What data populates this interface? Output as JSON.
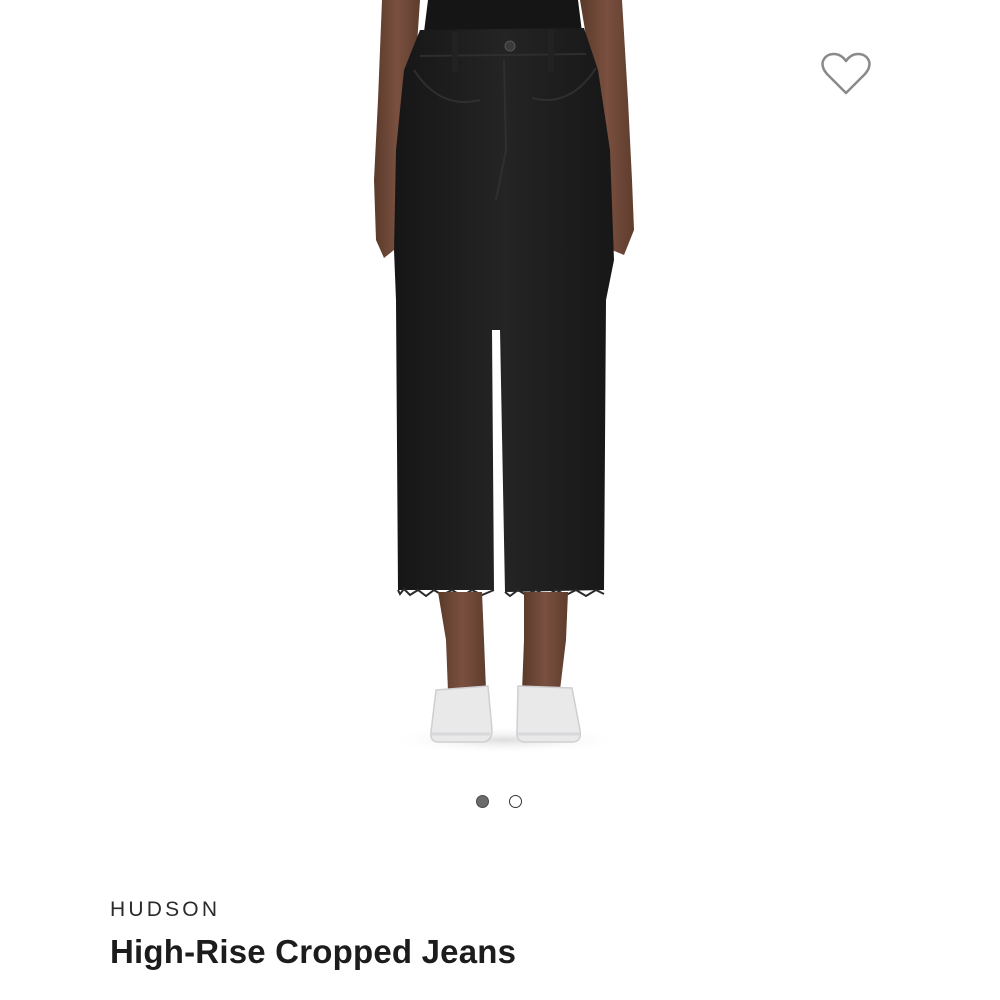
{
  "product": {
    "brand": "HUDSON",
    "title": "High-Rise Cropped Jeans"
  },
  "gallery": {
    "image_count": 2,
    "current_index": 1
  },
  "icons": {
    "wishlist": "heart-outline-icon"
  },
  "colors": {
    "jeans": "#1e1e1e",
    "background": "#ffffff",
    "active_dot": "#6b6b6b"
  }
}
